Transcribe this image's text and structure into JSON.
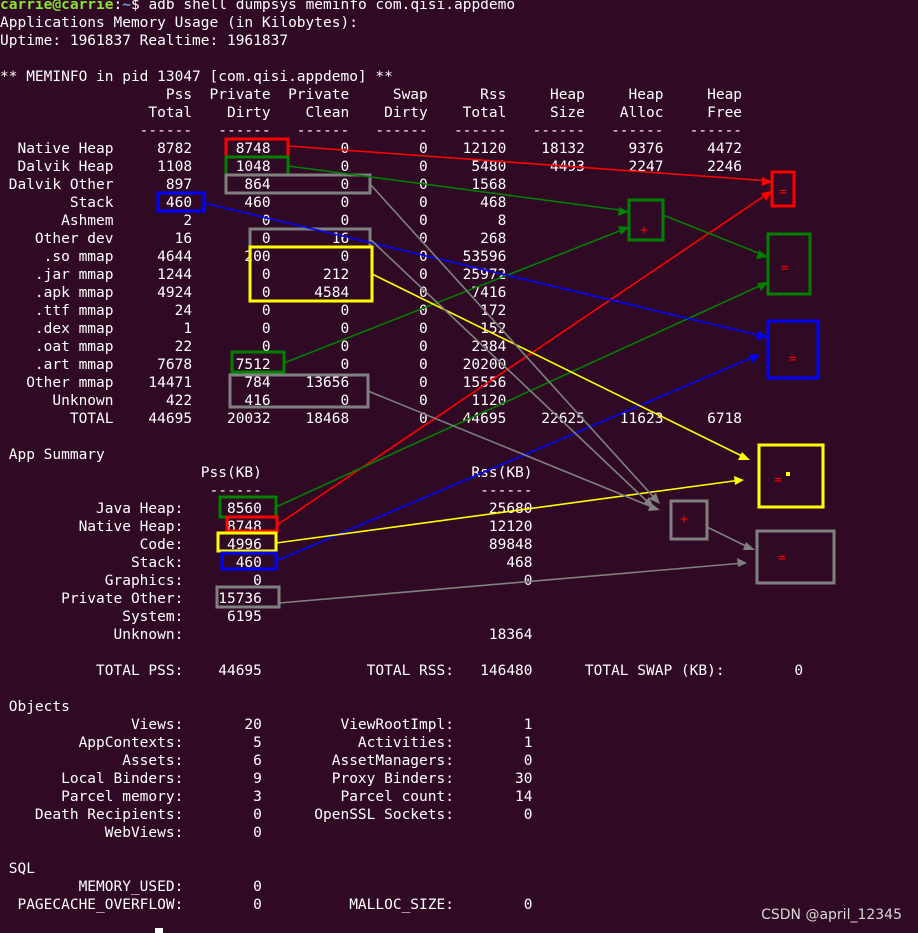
{
  "terminal": {
    "prompt_user": "carrie@carrie",
    "prompt_sep": ":",
    "prompt_path": "~",
    "prompt_dollar": "$ ",
    "command": "adb shell dumpsys meminfo com.qisi.appdemo",
    "lines": [
      "Applications Memory Usage (in Kilobytes):",
      "Uptime: 1961837 Realtime: 1961837",
      "",
      "** MEMINFO in pid 13047 [com.qisi.appdemo] **",
      "                   Pss  Private  Private     Swap      Rss     Heap     Heap     Heap",
      "                 Total    Dirty    Clean    Dirty    Total     Size    Alloc     Free",
      "                ------   ------   ------   ------   ------   ------   ------   ------",
      "  Native Heap     8782     8748        0        0    12120    18132     9376     4472",
      "  Dalvik Heap     1108     1048        0        0     5480     4493     2247     2246",
      " Dalvik Other      897      864        0        0     1568",
      "        Stack      460      460        0        0      468",
      "       Ashmem        2        0        0        0        8",
      "    Other dev       16        0       16        0      268",
      "     .so mmap     4644      200        0        0    53596",
      "    .jar mmap     1244        0      212        0    25972",
      "    .apk mmap     4924        0     4584        0     7416",
      "    .ttf mmap       24        0        0        0      172",
      "    .dex mmap        1        0        0        0      152",
      "    .oat mmap       22        0        0        0     2384",
      "    .art mmap     7678     7512        0        0    20200",
      "   Other mmap    14471      784    13656        0    15556",
      "      Unknown      422      416        0        0     1120",
      "        TOTAL    44695    20032    18468        0    44695    22625    11623     6718",
      "",
      " App Summary",
      "                       Pss(KB)                        Rss(KB)",
      "                        ------                         ------",
      "           Java Heap:     8560                          25680",
      "         Native Heap:     8748                          12120",
      "                Code:     4996                          89848",
      "               Stack:      460                            468",
      "            Graphics:        0                              0",
      "       Private Other:    15736",
      "              System:     6195",
      "             Unknown:                                   18364",
      "",
      "           TOTAL PSS:    44695            TOTAL RSS:   146480      TOTAL SWAP (KB):        0",
      "",
      " Objects",
      "               Views:       20         ViewRootImpl:        1",
      "         AppContexts:        5           Activities:        1",
      "              Assets:        6        AssetManagers:        0",
      "       Local Binders:        9        Proxy Binders:       30",
      "       Parcel memory:        3         Parcel count:       14",
      "    Death Recipients:        0      OpenSSL Sockets:        0",
      "            WebViews:        0",
      "",
      " SQL",
      "         MEMORY_USED:        0",
      "  PAGECACHE_OVERFLOW:        0          MALLOC_SIZE:        0"
    ]
  },
  "annotations": {
    "plus_symbol": "+",
    "equals_symbol": "=",
    "colors": {
      "red": "#ff0000",
      "green": "#008000",
      "blue": "#0000ff",
      "yellow": "#ffff00",
      "gray": "#808080"
    }
  },
  "watermark": "CSDN @april_12345"
}
